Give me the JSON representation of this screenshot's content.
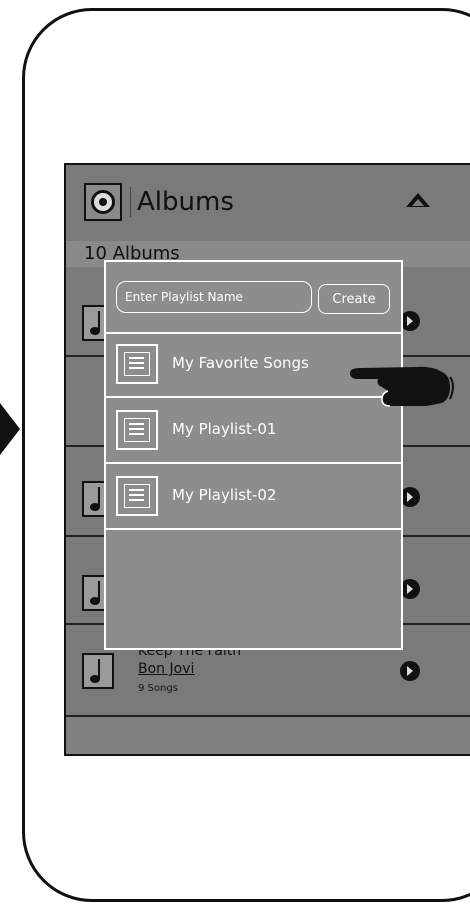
{
  "header": {
    "title": "Albums"
  },
  "album_count": "10 Albums",
  "albums": [
    {
      "name": "Keep The Faith",
      "artist": "Bon Jovi",
      "songs": "9 Songs"
    }
  ],
  "playlist_dialog": {
    "placeholder": "Enter Playlist Name",
    "create_label": "Create",
    "playlists": [
      {
        "label": "My Favorite Songs"
      },
      {
        "label": "My Playlist-01"
      },
      {
        "label": "My Playlist-02"
      }
    ]
  }
}
